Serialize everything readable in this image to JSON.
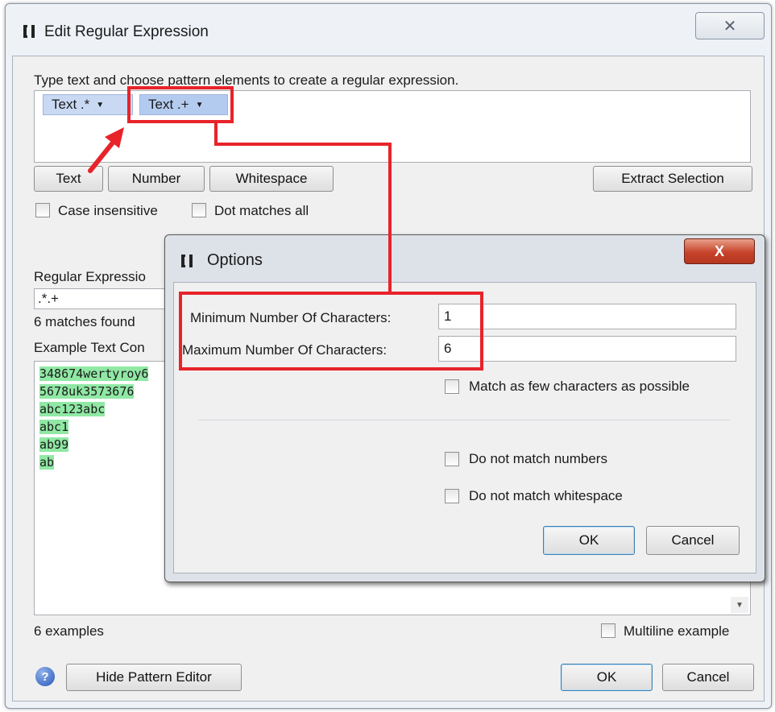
{
  "main": {
    "title": "Edit Regular Expression",
    "close_glyph": "✕",
    "instruction": "Type text and choose pattern elements to create a regular expression.",
    "tokens": [
      {
        "label": "Text .*",
        "arrow": "▼"
      },
      {
        "label": "Text .+",
        "arrow": "▼"
      }
    ],
    "element_buttons": {
      "text": "Text",
      "number": "Number",
      "whitespace": "Whitespace"
    },
    "extract_selection": "Extract Selection",
    "case_insensitive": "Case insensitive",
    "dot_matches_all": "Dot matches all",
    "regex_label": "Regular Expressio",
    "regex_value": ".*.+",
    "matches_found": "6 matches found",
    "example_label": "Example Text Con",
    "examples": [
      "348674wertyroy6",
      "5678uk3573676",
      "abc123abc",
      "abc1",
      "ab99",
      "ab"
    ],
    "examples_count": "6 examples",
    "multiline_example": "Multiline example",
    "help_glyph": "?",
    "hide_pattern_editor": "Hide Pattern Editor",
    "ok": "OK",
    "cancel": "Cancel",
    "scroll_down_glyph": "▼"
  },
  "options": {
    "title": "Options",
    "close_glyph": "X",
    "min_label": "Minimum Number Of Characters:",
    "min_value": "1",
    "max_label": "Maximum Number Of Characters:",
    "max_value": "6",
    "few_chars": "Match as few characters as possible",
    "no_numbers": "Do not match numbers",
    "no_whitespace": "Do not match whitespace",
    "ok": "OK",
    "cancel": "Cancel"
  },
  "colors": {
    "annotation": "#e8232a",
    "match_highlight": "#90e8a4",
    "token_bg": "#c9d9f4"
  }
}
